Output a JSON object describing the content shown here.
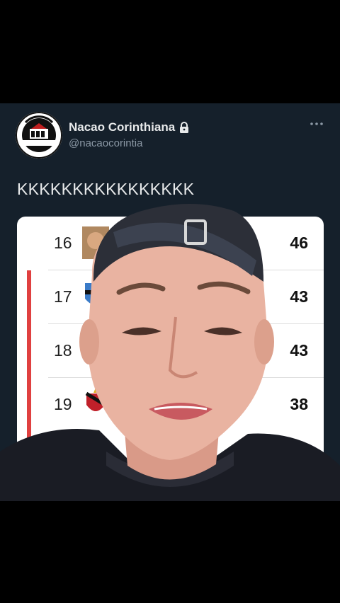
{
  "account": {
    "name": "Nacao Corinthiana",
    "handle": "@nacaocorintia",
    "avatar_text_top": "CORINTHIANS PAULI",
    "avatar_text_bottom": "NAÇAO CORINTHIANA",
    "lock_icon": "lock-icon",
    "more_icon": "more-dots-icon"
  },
  "tweet": {
    "text": "KKKKKKKKKKKKKKKK"
  },
  "standings": {
    "rows": [
      {
        "position": "16",
        "points": "46"
      },
      {
        "position": "17",
        "points": "43"
      },
      {
        "position": "18",
        "points": "43"
      },
      {
        "position": "19",
        "points": "38"
      }
    ],
    "relegation_color": "#e04040"
  },
  "colors": {
    "background": "#15202b",
    "text_primary": "#e7e9ea",
    "text_secondary": "#8b98a5"
  }
}
